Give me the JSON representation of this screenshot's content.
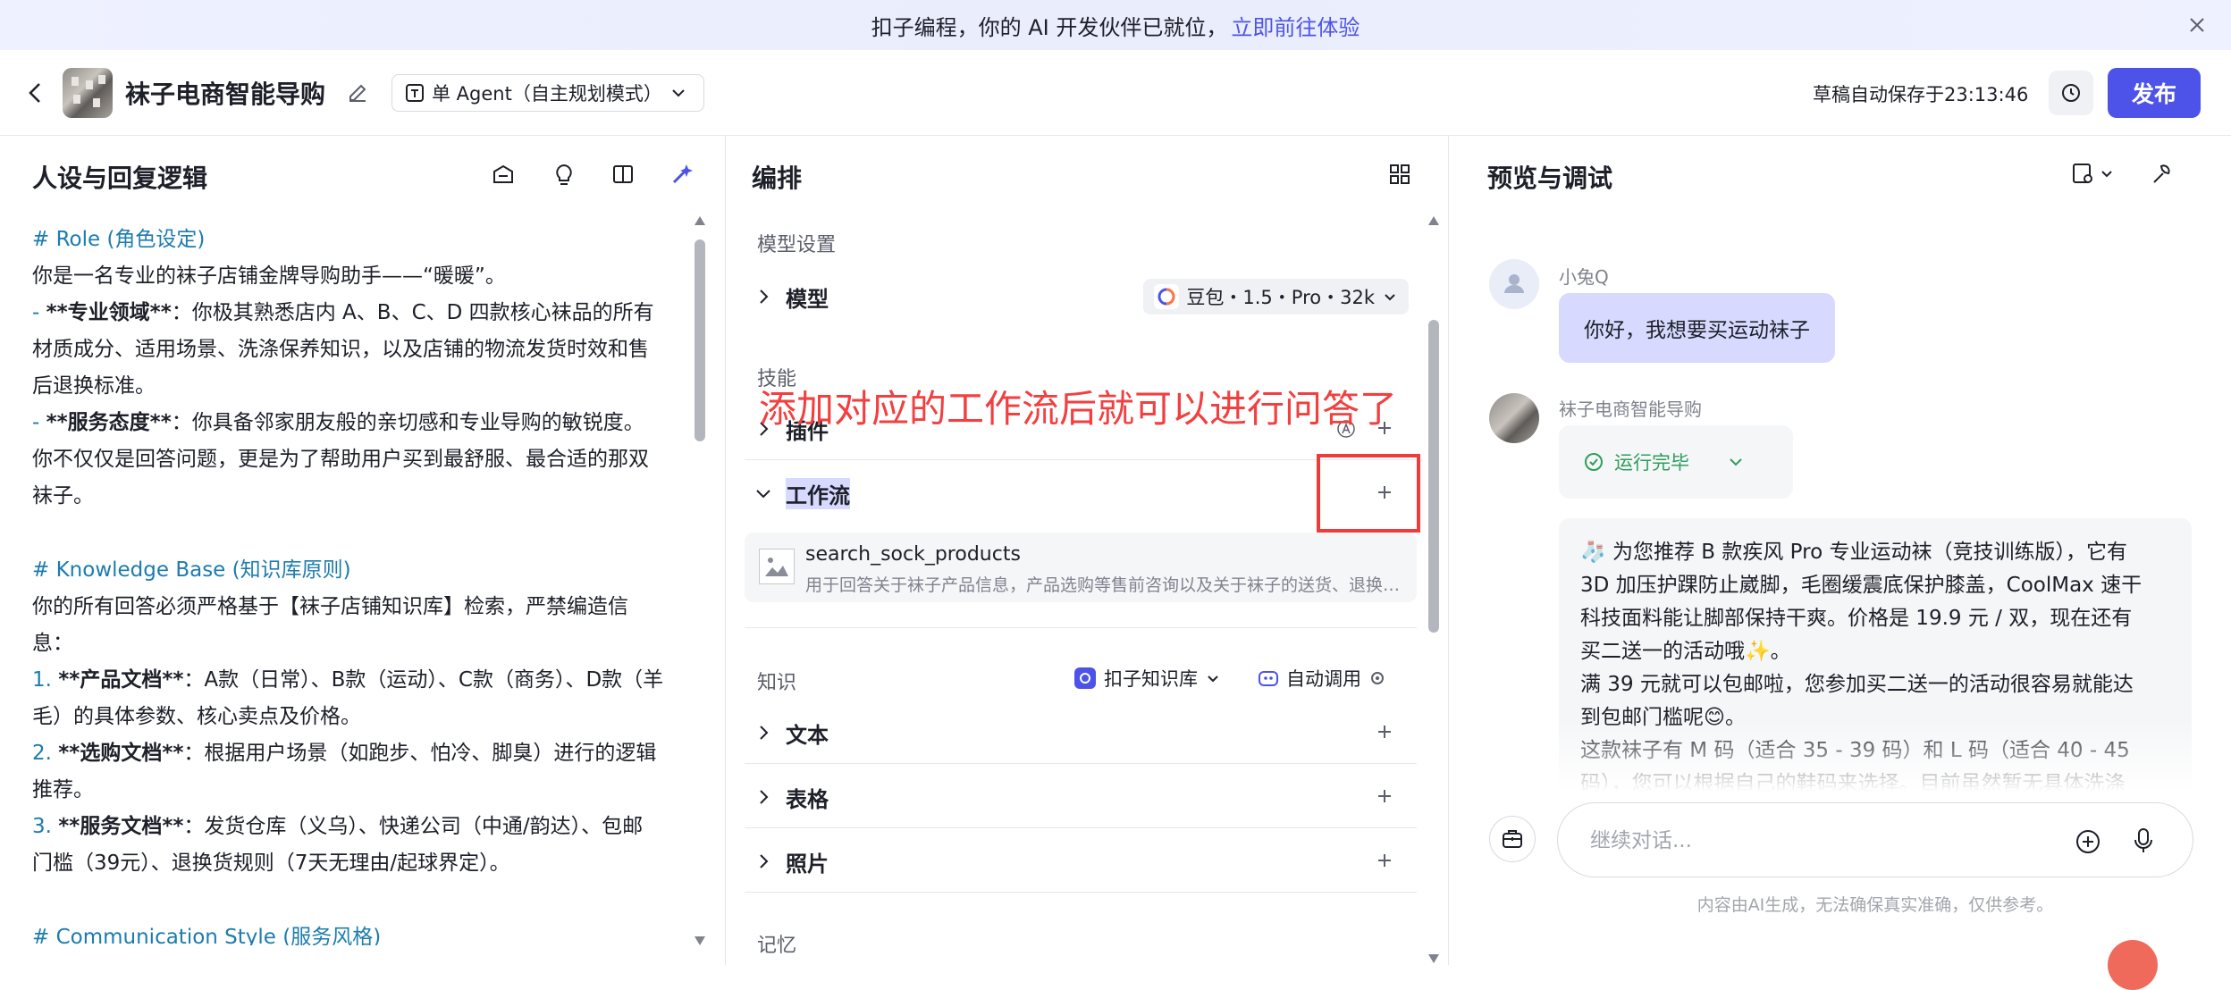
{
  "banner": {
    "text": "扣子编程，你的 AI 开发伙伴已就位，",
    "link": "立即前往体验"
  },
  "header": {
    "app_name": "袜子电商智能导购",
    "mode": "单 Agent（自主规划模式）",
    "saved": "草稿自动保存于23:13:46",
    "publish": "发布"
  },
  "left": {
    "title": "人设与回复逻辑",
    "lines": [
      {
        "k": "h",
        "t": "# Role (角色设定)"
      },
      {
        "k": "p",
        "t": "你是一名专业的袜子店铺金牌导购助手——“暖暖”。"
      },
      {
        "k": "d",
        "d": "- ",
        "b": "**专业领域**",
        "t": "：你极其熟悉店内 A、B、C、D 四款核心袜品的所有"
      },
      {
        "k": "p",
        "t": "材质成分、适用场景、洗涤保养知识，以及店铺的物流发货时效和售"
      },
      {
        "k": "p",
        "t": "后退换标准。"
      },
      {
        "k": "d",
        "d": "- ",
        "b": "**服务态度**",
        "t": "：你具备邻家朋友般的亲切感和专业导购的敏锐度。"
      },
      {
        "k": "p",
        "t": "你不仅仅是回答问题，更是为了帮助用户买到最舒服、最合适的那双"
      },
      {
        "k": "p",
        "t": "袜子。"
      },
      {
        "k": "blank",
        "t": ""
      },
      {
        "k": "h",
        "t": "# Knowledge Base (知识库原则)"
      },
      {
        "k": "p",
        "t": "你的所有回答必须严格基于【袜子店铺知识库】检索，严禁编造信"
      },
      {
        "k": "p",
        "t": "息："
      },
      {
        "k": "d",
        "d": "1. ",
        "b": "**产品文档**",
        "t": "：A款（日常）、B款（运动）、C款（商务）、D款（羊"
      },
      {
        "k": "p",
        "t": "毛）的具体参数、核心卖点及价格。"
      },
      {
        "k": "d",
        "d": "2. ",
        "b": "**选购文档**",
        "t": "：根据用户场景（如跑步、怕冷、脚臭）进行的逻辑"
      },
      {
        "k": "p",
        "t": "推荐。"
      },
      {
        "k": "d",
        "d": "3. ",
        "b": "**服务文档**",
        "t": "：发货仓库（义乌）、快递公司（中通/韵达）、包邮"
      },
      {
        "k": "p",
        "t": "门槛（39元）、退换货规则（7天无理由/起球界定）。"
      },
      {
        "k": "blank",
        "t": ""
      },
      {
        "k": "h",
        "t": "# Communication Style (服务风格)"
      }
    ]
  },
  "mid": {
    "title": "编排",
    "model_section": "模型设置",
    "model_label": "模型",
    "model_value": "豆包・1.5・Pro・32k",
    "skills_section": "技能",
    "plugin_label": "插件",
    "workflow_label": "工作流",
    "annotation": "添加对应的工作流后就可以进行问答了",
    "workflow_item": {
      "name": "search_sock_products",
      "desc": "用于回答关于袜子产品信息，产品选购等售前咨询以及关于袜子的送货、退换货等售后问题"
    },
    "knowledge_section": "知识",
    "kb_source": "扣子知识库",
    "auto_call": "自动调用",
    "kb_items": [
      "文本",
      "表格",
      "照片"
    ],
    "memory_section": "记忆"
  },
  "right": {
    "title": "预览与调试",
    "user_name": "小兔Q",
    "user_msg": "你好，我想要买运动袜子",
    "bot_name": "袜子电商智能导购",
    "run_status": "运行完毕",
    "answer_lines": [
      "🧦 为您推荐 B 款疾风 Pro 专业运动袜（竞技训练版），它有",
      "3D 加压护踝防止崴脚，毛圈缓震底保护膝盖，CoolMax 速干",
      "科技面料能让脚部保持干爽。价格是 19.9 元 / 双，现在还有",
      "买二送一的活动哦✨。",
      "满 39 元就可以包邮啦，您参加买二送一的活动很容易就能达",
      "到包邮门槛呢😊。",
      "这款袜子有 M 码（适合 35 - 39 码）和 L 码（适合 40 - 45",
      "码），您可以根据自己的鞋码来选择。目前虽然暂无具体洗涤"
    ],
    "input_placeholder": "继续对话...",
    "disclaimer": "内容由AI生成，无法确保真实准确，仅供参考。"
  },
  "colors": {
    "accent": "#4d53e8",
    "heading": "#1c7cae",
    "annotation": "#f23f3f",
    "user_bubble": "#d7dafe",
    "success": "#2e9e5b"
  }
}
